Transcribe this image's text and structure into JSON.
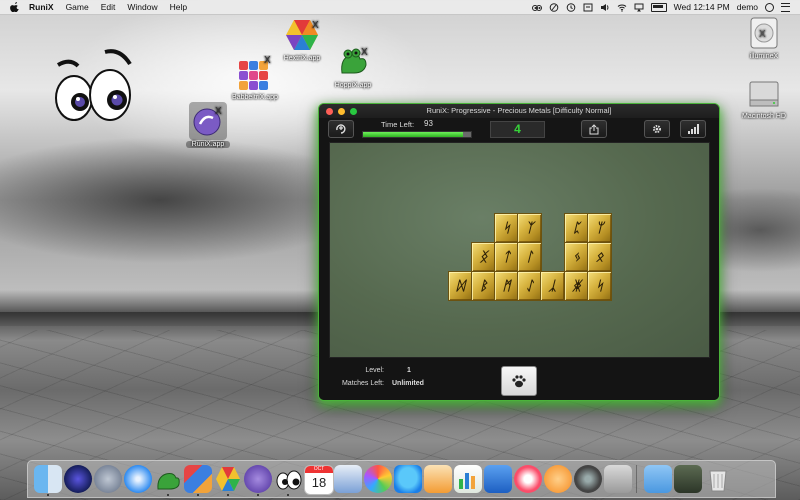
{
  "menubar": {
    "app_name": "RuniX",
    "menus": [
      "Game",
      "Edit",
      "Window",
      "Help"
    ],
    "clock": "Wed 12:14 PM",
    "user": "demo"
  },
  "desktop_icons": {
    "hextrix": "HextriX.app",
    "hoppix": "HoppiX.app",
    "babbeltrix": "BabbeltriX.app",
    "runix": "RuniX.app",
    "illuminex": "illumineX",
    "macintosh_hd": "Macintosh HD"
  },
  "window": {
    "title": "RuniX:  Progressive - Precious Metals [Difficulty Normal]",
    "time_left_label": "Time Left:",
    "time_left_value": "93",
    "time_left_fraction": 0.93,
    "score": "4",
    "level_label": "Level:",
    "level_value": "1",
    "matches_left_label": "Matches Left:",
    "matches_left_value": "Unlimited"
  },
  "board": {
    "tile_glyphs": [
      "ᛋ",
      "ᛉ",
      "ᛈ",
      "ᛘ",
      "ᛝ",
      "ᛏ",
      "ᛚ",
      "ᛃ",
      "ᛟ",
      "ᛞ",
      "ᛒ",
      "ᛗ",
      "ᛇ",
      "ᛣ",
      "ᛤ"
    ]
  },
  "colors": {
    "accent_green": "#37d33a",
    "window_glow": "#4bb43b",
    "board_felt": "#56694f",
    "tile_gold": "#d7b440"
  },
  "dock": {
    "apps": [
      "finder-icon",
      "siri-icon",
      "launchpad-icon",
      "safari-icon",
      "hoppix-icon",
      "babbeltrix-icon",
      "hextrix-icon",
      "runix-icon",
      "illuminex-icon",
      "calendar-icon",
      "preview-icon",
      "photos-icon",
      "messages-icon",
      "pages-icon",
      "numbers-icon",
      "keynote-icon",
      "music-icon",
      "books-icon",
      "system-preferences-icon",
      "xcode-icon",
      "downloads-folder-icon",
      "screenshot-icon",
      "trash-icon"
    ],
    "calendar_month": "OCT",
    "calendar_day": "18"
  }
}
